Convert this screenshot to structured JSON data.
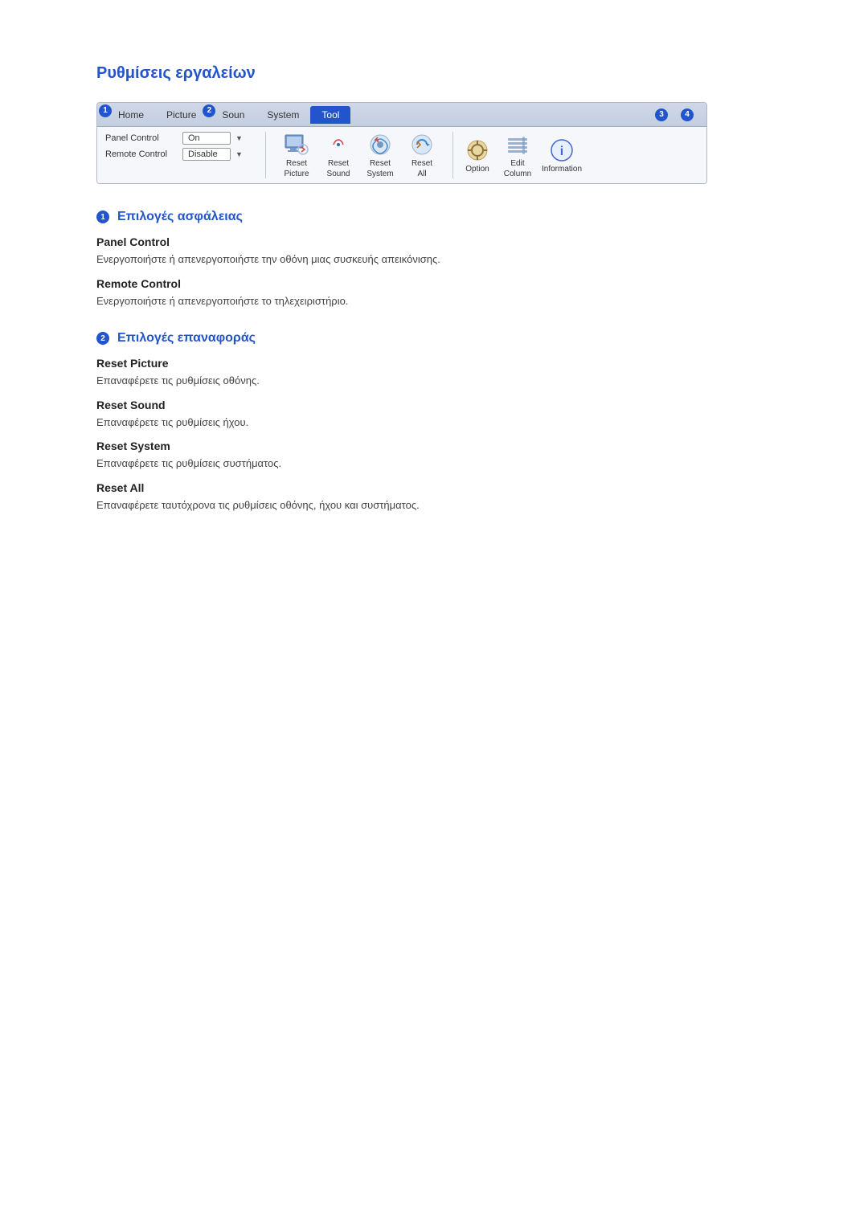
{
  "page": {
    "title": "Ρυθμίσεις εργαλείων"
  },
  "toolbar": {
    "tabs": [
      {
        "id": "home",
        "label": "Home",
        "active": false,
        "num": "1"
      },
      {
        "id": "picture",
        "label": "Picture",
        "active": false
      },
      {
        "id": "sound",
        "label": "Soun",
        "active": false,
        "num": "2"
      },
      {
        "id": "system",
        "label": "System",
        "active": false
      },
      {
        "id": "tool",
        "label": "Tool",
        "active": true
      },
      {
        "id": "group3",
        "label": "",
        "num": "3"
      },
      {
        "id": "group4",
        "label": "",
        "num": "4"
      }
    ],
    "controls": [
      {
        "label": "Panel Control",
        "value": "On"
      },
      {
        "label": "Remote Control",
        "value": "Disable"
      }
    ],
    "reset_buttons": [
      {
        "id": "reset-picture",
        "label1": "Reset",
        "label2": "Picture"
      },
      {
        "id": "reset-sound",
        "label1": "Reset",
        "label2": "Sound"
      },
      {
        "id": "reset-system",
        "label1": "Reset",
        "label2": "System"
      },
      {
        "id": "reset-all",
        "label1": "Reset",
        "label2": "All"
      }
    ],
    "right_buttons": [
      {
        "id": "option",
        "label": "Option"
      },
      {
        "id": "edit-column",
        "label1": "Edit",
        "label2": "Column"
      },
      {
        "id": "information",
        "label": "Information"
      }
    ]
  },
  "sections": [
    {
      "id": "security",
      "num": "1",
      "heading": "Επιλογές ασφάλειας",
      "items": [
        {
          "id": "panel-control",
          "label": "Panel Control",
          "description": "Ενεργοποιήστε ή απενεργοποιήστε την οθόνη μιας συσκευής απεικόνισης."
        },
        {
          "id": "remote-control",
          "label": "Remote Control",
          "description": "Ενεργοποιήστε ή απενεργοποιήστε το τηλεχειριστήριο."
        }
      ]
    },
    {
      "id": "reset",
      "num": "2",
      "heading": "Επιλογές επαναφοράς",
      "items": [
        {
          "id": "reset-picture",
          "label": "Reset Picture",
          "description": "Επαναφέρετε τις ρυθμίσεις οθόνης."
        },
        {
          "id": "reset-sound",
          "label": "Reset Sound",
          "description": "Επαναφέρετε τις ρυθμίσεις ήχου."
        },
        {
          "id": "reset-system",
          "label": "Reset System",
          "description": "Επαναφέρετε τις ρυθμίσεις συστήματος."
        },
        {
          "id": "reset-all",
          "label": "Reset All",
          "description": "Επαναφέρετε ταυτόχρονα τις ρυθμίσεις οθόνης, ήχου και συστήματος."
        }
      ]
    }
  ]
}
